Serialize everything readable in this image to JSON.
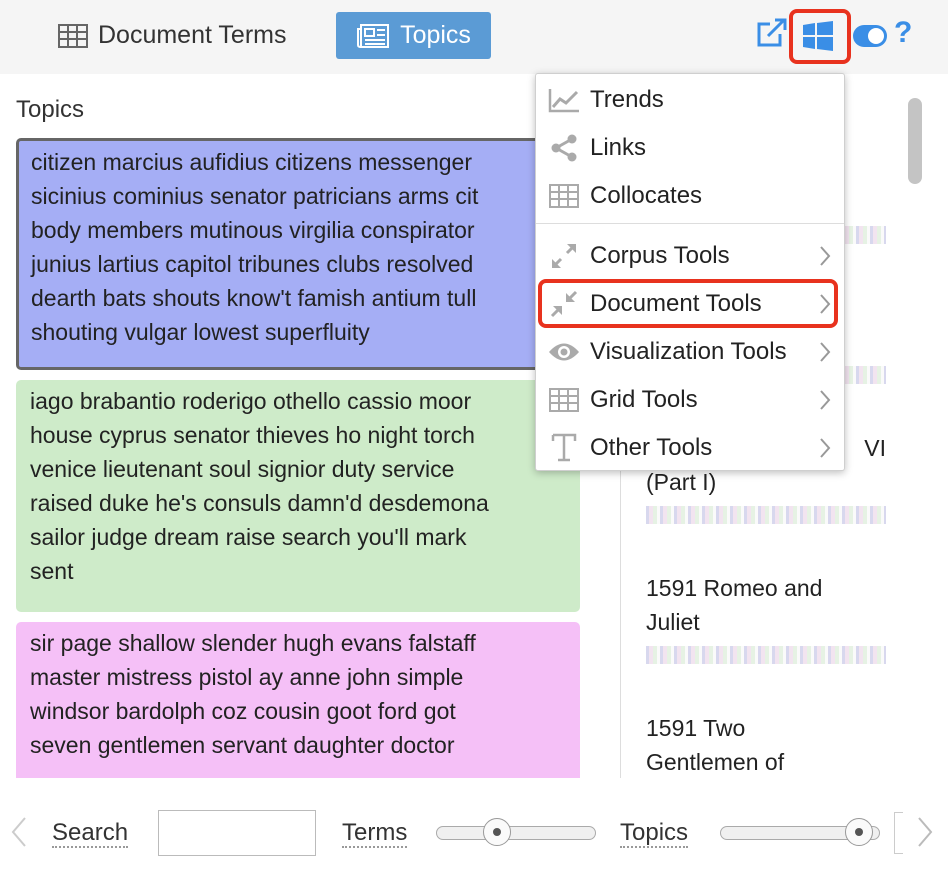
{
  "tabs": {
    "document_terms": "Document Terms",
    "topics": "Topics"
  },
  "toolbar": {
    "help": "?",
    "icons": [
      "export-icon",
      "windows-icon",
      "toggle-icon",
      "help-icon"
    ]
  },
  "left_panel": {
    "title": "Topics",
    "topics": [
      [
        "citizen marcius aufidius citizens messenger",
        "sicinius cominius senator patricians arms cit",
        "body members mutinous virgilia conspirator",
        "junius lartius capitol tribunes clubs resolved",
        "dearth bats shouts know't famish antium tull",
        "shouting vulgar lowest superfluity"
      ],
      [
        "iago brabantio roderigo othello cassio moor",
        "house cyprus senator thieves ho night torch",
        "venice lieutenant soul signior duty service",
        "raised duke he's consuls damn'd desdemona",
        "sailor judge dream raise search you'll mark",
        "sent"
      ],
      [
        "sir page shallow slender hugh evans falstaff",
        "master mistress pistol ay anne john simple",
        "windsor bardolph coz cousin goot ford got",
        "seven gentlemen servant daughter doctor"
      ]
    ]
  },
  "right_panel": {
    "doc_fragment": [
      "VI",
      "(Part I)"
    ],
    "docs": [
      [
        "1591 Romeo and",
        "Juliet"
      ],
      [
        "1591 Two",
        "Gentlemen of"
      ]
    ]
  },
  "menu": {
    "items": [
      {
        "label": "Trends",
        "icon": "trends-icon",
        "submenu": false
      },
      {
        "label": "Links",
        "icon": "share-icon",
        "submenu": false
      },
      {
        "label": "Collocates",
        "icon": "table-icon",
        "submenu": false
      },
      {
        "label": "Corpus Tools",
        "icon": "expand-icon",
        "submenu": true
      },
      {
        "label": "Document Tools",
        "icon": "compress-icon",
        "submenu": true
      },
      {
        "label": "Visualization Tools",
        "icon": "eye-icon",
        "submenu": true
      },
      {
        "label": "Grid Tools",
        "icon": "grid-icon",
        "submenu": true
      },
      {
        "label": "Other Tools",
        "icon": "text-tool-icon",
        "submenu": true
      }
    ]
  },
  "bottom": {
    "search_label": "Search",
    "search_value": "",
    "terms_label": "Terms",
    "topics_label": "Topics",
    "terms_level": 0.35,
    "topics_level": 0.95
  },
  "colors": {
    "tab_active": "#5b9bd5",
    "highlight": "#e8321e",
    "topic1": "#a5aef5",
    "topic2": "#ceebc9",
    "topic3": "#f5c0f7",
    "icon_blue": "#3a8ee6"
  }
}
